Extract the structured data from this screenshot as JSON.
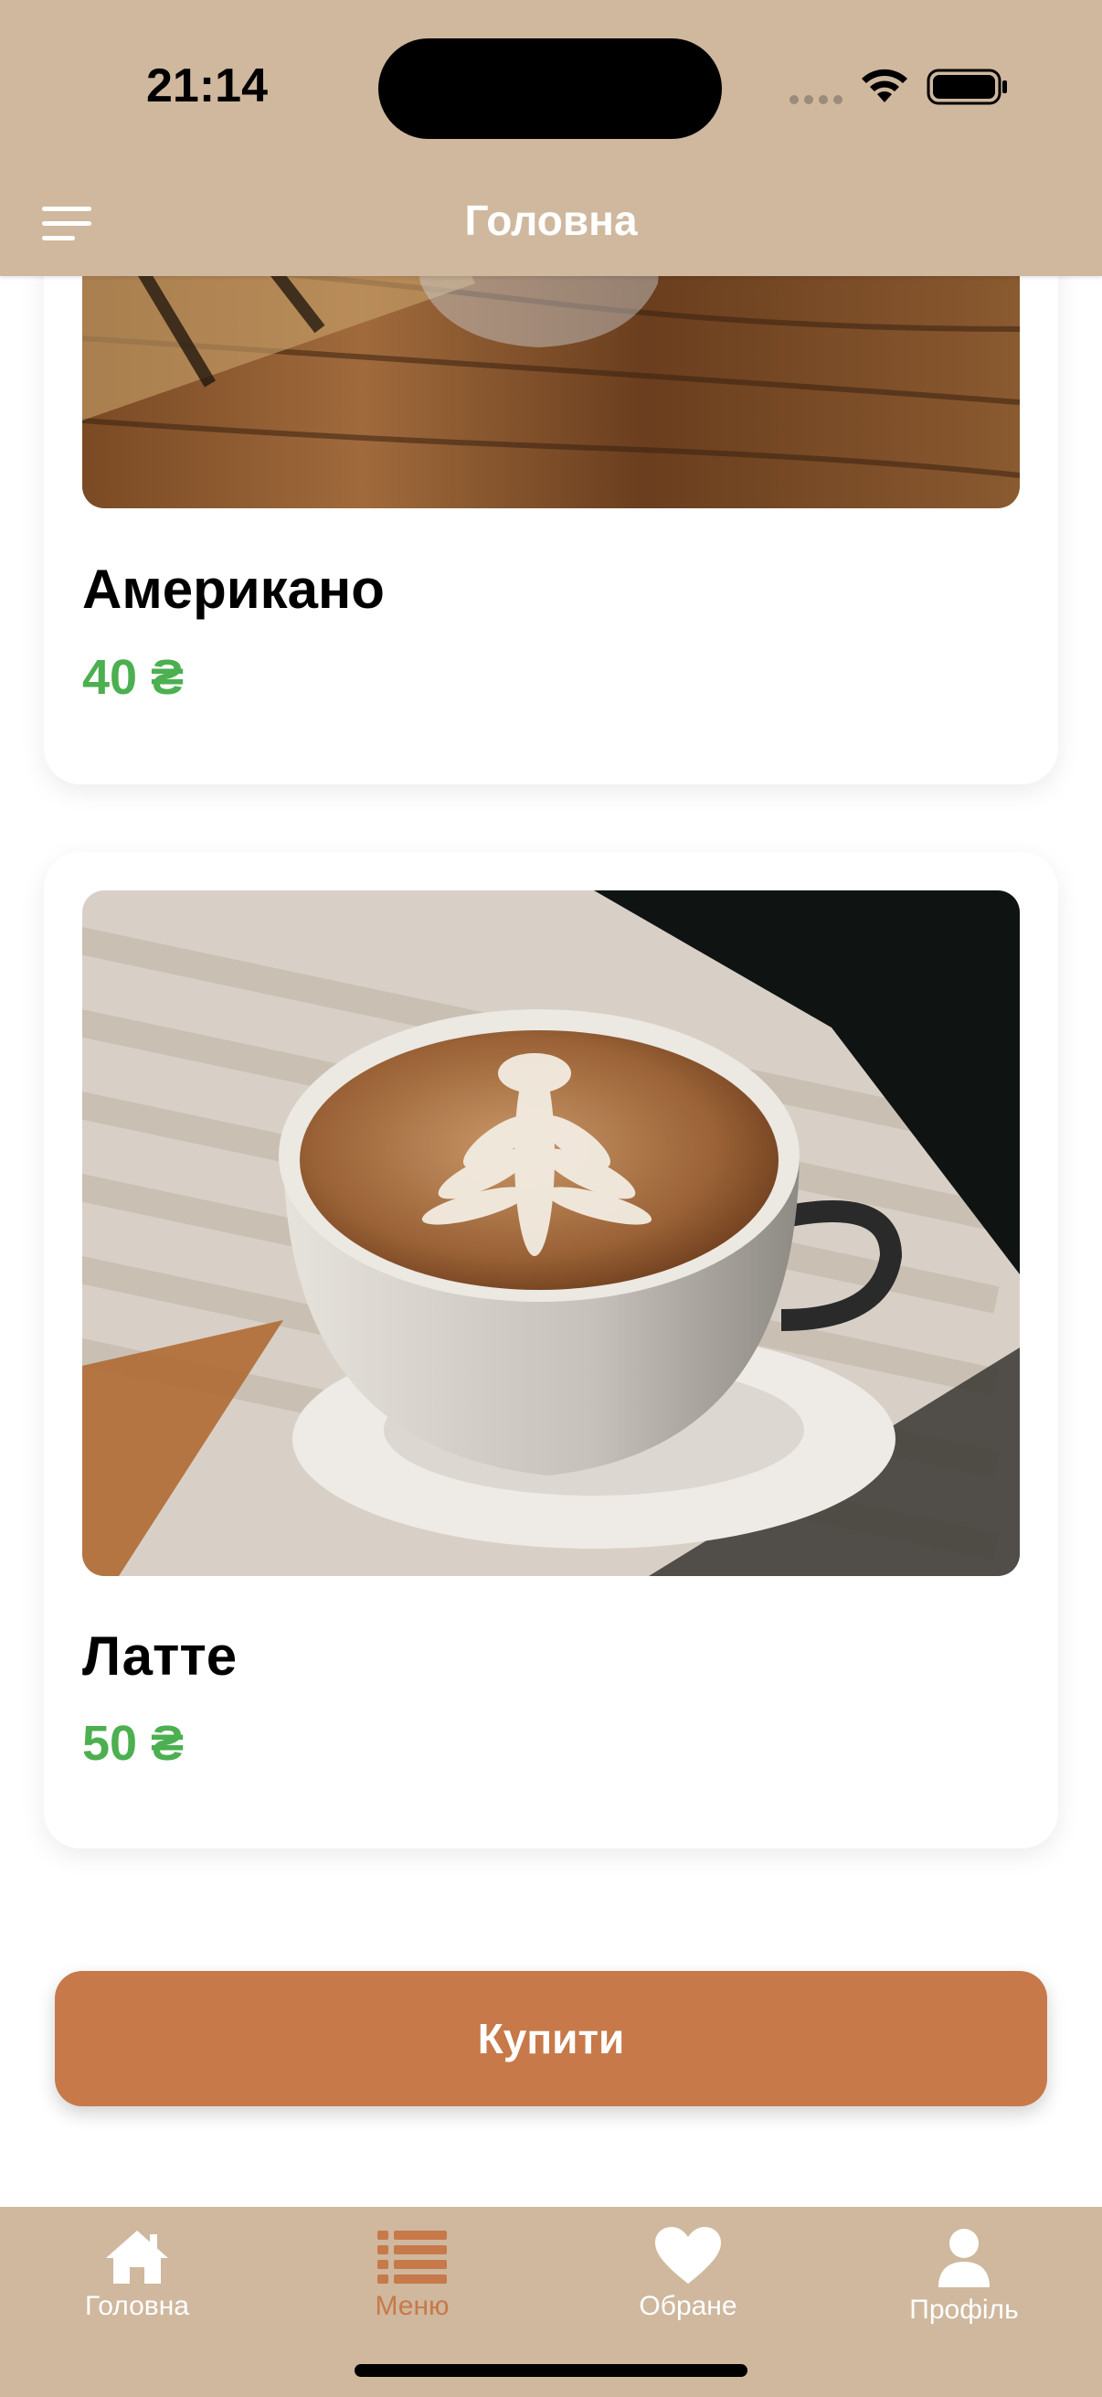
{
  "status_bar": {
    "time": "21:14"
  },
  "header": {
    "title": "Головна",
    "menu_icon": "hamburger-menu-icon"
  },
  "products": [
    {
      "name": "Американо",
      "price": "40 ₴"
    },
    {
      "name": "Латте",
      "price": "50 ₴"
    }
  ],
  "buy_button": {
    "label": "Купити"
  },
  "tabbar": {
    "items": [
      {
        "label": "Головна",
        "icon": "home-icon",
        "active": false
      },
      {
        "label": "Меню",
        "icon": "list-icon",
        "active": true
      },
      {
        "label": "Обране",
        "icon": "heart-icon",
        "active": false
      },
      {
        "label": "Профіль",
        "icon": "person-icon",
        "active": false
      }
    ]
  },
  "colors": {
    "header_bg": "#cfb89e",
    "accent": "#c7794a",
    "price": "#4caf50"
  }
}
